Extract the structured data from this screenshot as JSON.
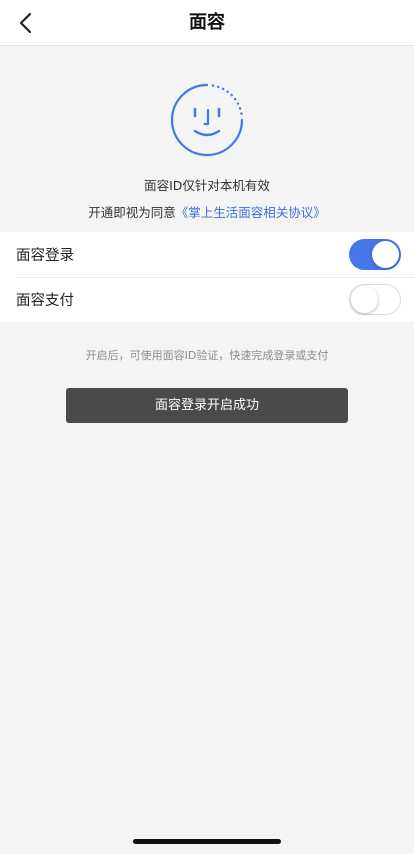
{
  "header": {
    "title": "面容",
    "back_icon": "chevron-left-icon"
  },
  "face": {
    "icon": "face-id-icon",
    "accent_color": "#4478ea"
  },
  "info": {
    "validity_text": "面容ID仅针对本机有效",
    "agreement_prefix": "开通即视为同意",
    "agreement_link": "《掌上生活面容相关协议》"
  },
  "settings": {
    "items": [
      {
        "label": "面容登录",
        "enabled": true
      },
      {
        "label": "面容支付",
        "enabled": false
      }
    ]
  },
  "hint": "开启后，可使用面容ID验证，快速完成登录或支付",
  "toast": "面容登录开启成功",
  "colors": {
    "accent": "#4478ea",
    "link": "#3b6fe0",
    "background": "#f4f4f4",
    "toast_bg": "#4a4a4a"
  }
}
